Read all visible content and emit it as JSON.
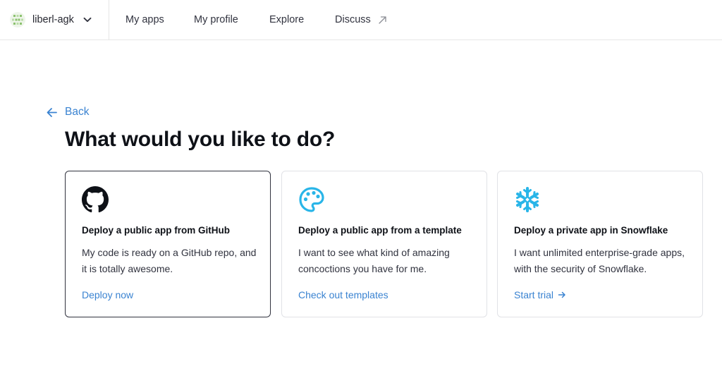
{
  "workspace": {
    "name": "liberl-agk",
    "avatar_icon": "identicon-avatar",
    "chevron_icon": "chevron-down-icon"
  },
  "nav": {
    "my_apps": "My apps",
    "my_profile": "My profile",
    "explore": "Explore",
    "discuss": "Discuss",
    "discuss_icon": "external-link-arrow-icon"
  },
  "back": {
    "label": "Back",
    "icon": "arrow-left-icon"
  },
  "page_title": "What would you like to do?",
  "cards": [
    {
      "icon": "github-icon",
      "title": "Deploy a public app from GitHub",
      "description": "My code is ready on a GitHub repo, and it is totally awesome.",
      "link": "Deploy now",
      "selected": true
    },
    {
      "icon": "palette-icon",
      "title": "Deploy a public app from a template",
      "description": "I want to see what kind of amazing concoctions you have for me.",
      "link": "Check out templates",
      "selected": false
    },
    {
      "icon": "snowflake-icon",
      "title": "Deploy a private app in Snowflake",
      "description": "I want unlimited enterprise-grade apps, with the security of Snowflake.",
      "link": "Start trial",
      "link_icon": "arrow-right-icon",
      "selected": false
    }
  ],
  "colors": {
    "link": "#3a83d1",
    "snowflake": "#29b5e8",
    "selected_border": "#31333f",
    "border": "#e1e2e6"
  }
}
